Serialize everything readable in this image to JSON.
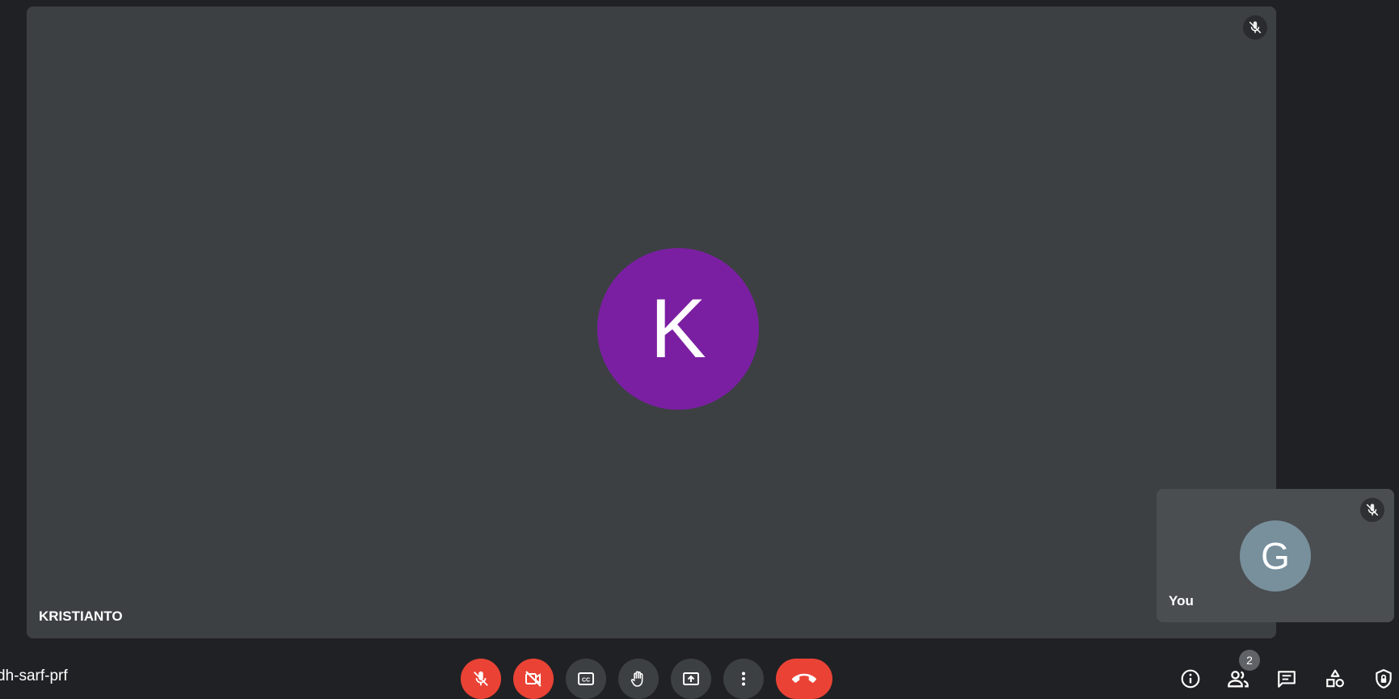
{
  "main_participant": {
    "name": "KRISTIANTO",
    "initial": "K",
    "avatar_color": "#7b1fa2",
    "mic_status_icon": "mic-off-icon"
  },
  "self_participant": {
    "name": "You",
    "initial": "G",
    "avatar_color": "#78909c",
    "mic_status_icon": "mic-off-icon"
  },
  "meeting": {
    "code": "dh-sarf-prf"
  },
  "controls": [
    {
      "name": "mic-toggle-button",
      "icon": "mic-off-icon",
      "state": "off",
      "color": "#ea4335"
    },
    {
      "name": "camera-toggle-button",
      "icon": "videocam-off-icon",
      "state": "off",
      "color": "#ea4335"
    },
    {
      "name": "captions-button",
      "icon": "closed-caption-icon"
    },
    {
      "name": "raise-hand-button",
      "icon": "hand-icon"
    },
    {
      "name": "present-screen-button",
      "icon": "present-to-all-icon"
    },
    {
      "name": "more-options-button",
      "icon": "more-vert-icon"
    },
    {
      "name": "leave-call-button",
      "icon": "call-end-icon",
      "color": "#ea4335"
    }
  ],
  "side_panel": {
    "participant_count": "2",
    "buttons": [
      {
        "name": "meeting-details-button",
        "icon": "info-icon"
      },
      {
        "name": "people-button",
        "icon": "people-icon"
      },
      {
        "name": "chat-button",
        "icon": "chat-icon"
      },
      {
        "name": "activities-button",
        "icon": "shapes-icon"
      },
      {
        "name": "host-controls-button",
        "icon": "shield-lock-icon"
      }
    ]
  }
}
